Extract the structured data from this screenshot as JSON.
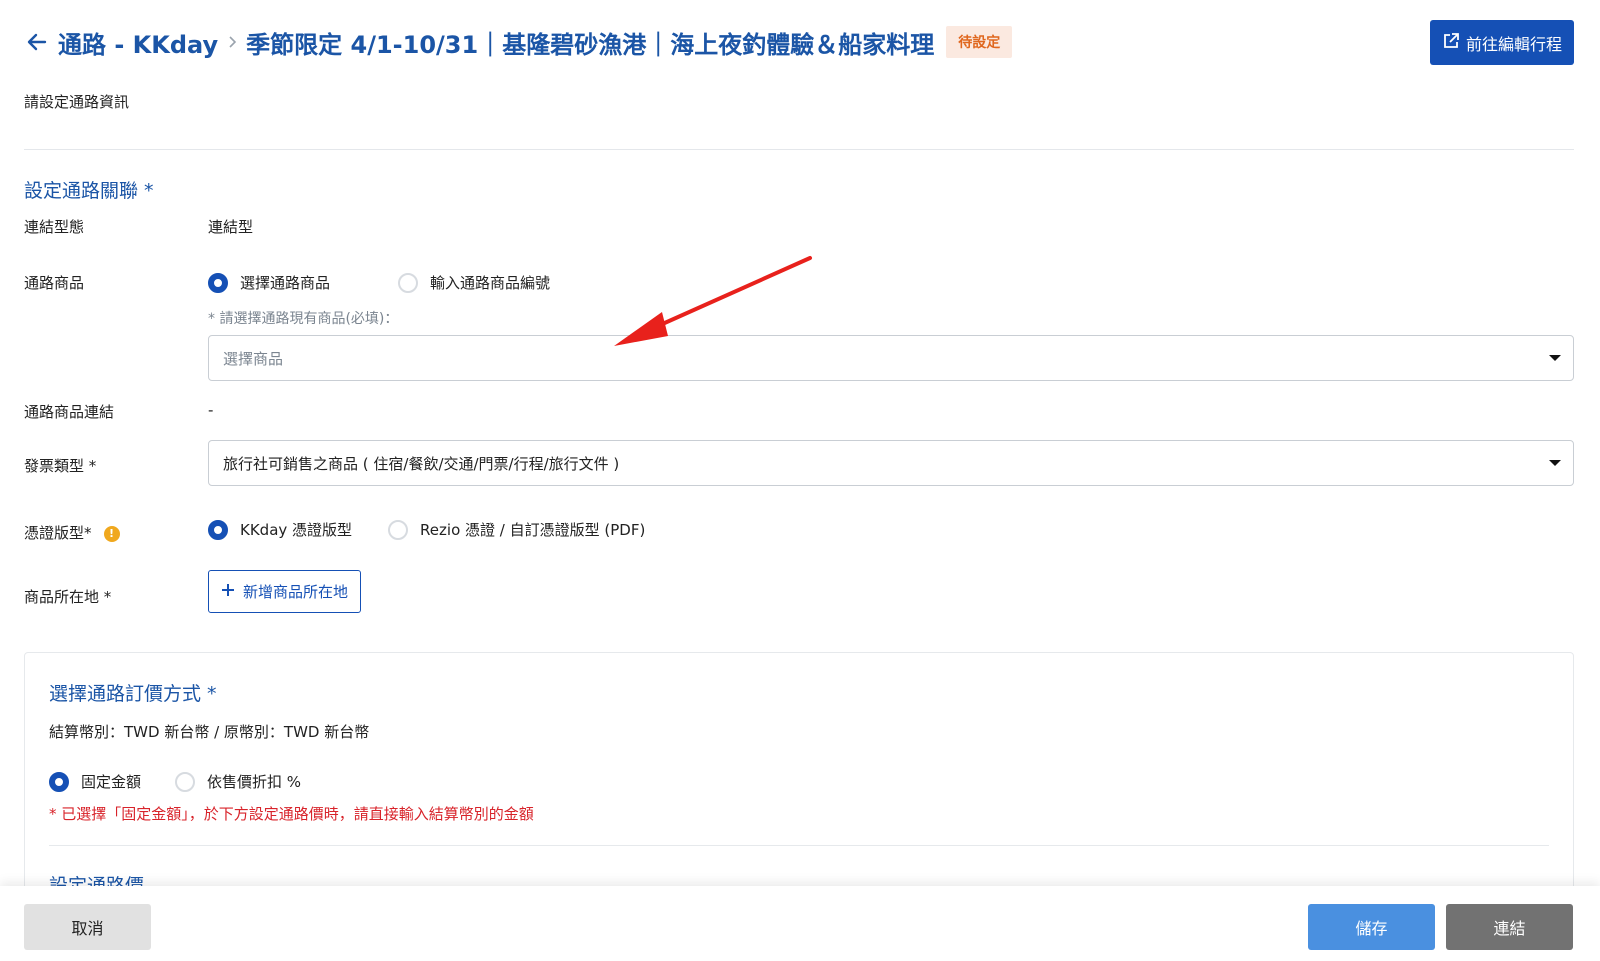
{
  "header": {
    "back_icon": "arrow-left-icon",
    "breadcrumb_parent": "通路 - KKday",
    "breadcrumb_title": "季節限定 4/1-10/31｜基隆碧砂漁港｜海上夜釣體驗＆船家料理",
    "status_badge": "待設定",
    "edit_button_label": "前往編輯行程",
    "edit_button_icon": "external-link-icon"
  },
  "page_description": "請設定通路資訊",
  "channel_section": {
    "title": "設定通路關聯 *",
    "link_type": {
      "label": "連結型態",
      "value": "連結型"
    },
    "channel_product": {
      "label": "通路商品",
      "options": [
        {
          "label": "選擇通路商品",
          "selected": true
        },
        {
          "label": "輸入通路商品編號",
          "selected": false
        }
      ],
      "select_hint": "* 請選擇通路現有商品(必填)：",
      "select_placeholder": "選擇商品"
    },
    "product_link": {
      "label": "通路商品連結",
      "value": "-"
    },
    "invoice_type": {
      "label": "發票類型 *",
      "value": "旅行社可銷售之商品 ( 住宿/餐飲/交通/門票/行程/旅行文件 )"
    },
    "voucher_type": {
      "label": "憑證版型*",
      "info_icon": "info-icon",
      "options": [
        {
          "label": "KKday 憑證版型",
          "selected": true
        },
        {
          "label": "Rezio 憑證 / 自訂憑證版型 (PDF)",
          "selected": false
        }
      ]
    },
    "product_location": {
      "label": "商品所在地 *",
      "add_button_label": "新增商品所在地",
      "add_icon": "plus-icon"
    }
  },
  "pricing_section": {
    "title": "選擇通路訂價方式 *",
    "currency_line": "結算幣別：TWD 新台幣 / 原幣別：TWD 新台幣",
    "options": [
      {
        "label": "固定金額",
        "selected": true
      },
      {
        "label": "依售價折扣 %",
        "selected": false
      }
    ],
    "warning": "* 已選擇「固定金額」，於下方設定通路價時，請直接輸入結算幣別的金額",
    "sub_title": "設定通路價"
  },
  "footer": {
    "cancel_label": "取消",
    "save_label": "儲存",
    "connect_label": "連結"
  },
  "colors": {
    "primary": "#1550b5",
    "title_blue": "#1b55a6",
    "badge_bg": "#fbe9e0",
    "badge_text": "#e0671e",
    "warning_red": "#d8232a",
    "save_blue": "#4a90e0",
    "connect_gray": "#727272",
    "annotation_arrow": "#e8211c"
  }
}
